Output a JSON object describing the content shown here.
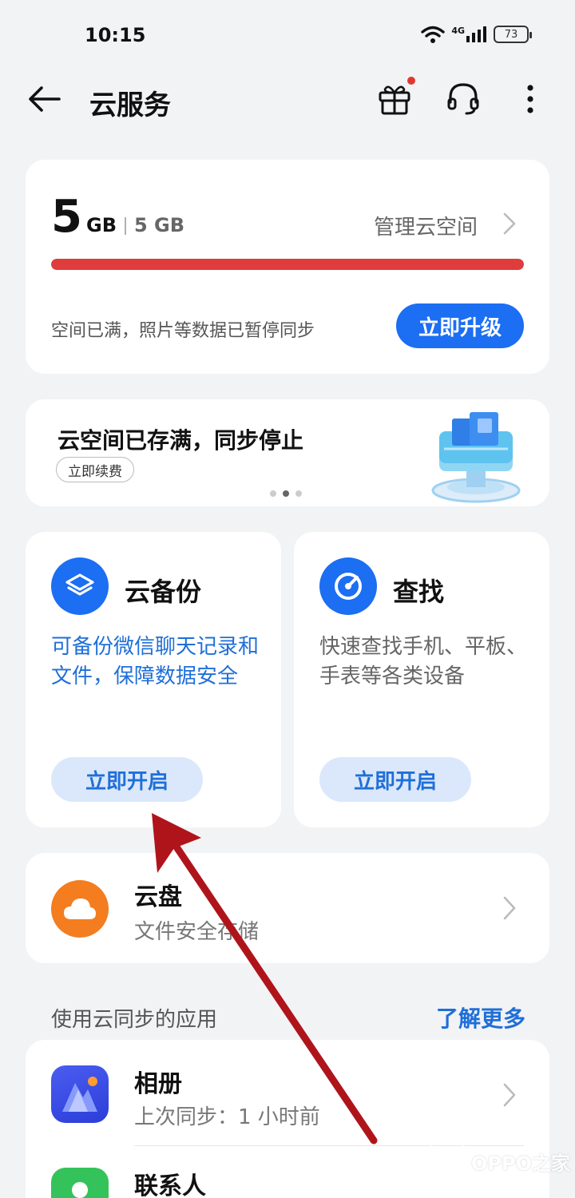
{
  "status_bar": {
    "time": "10:15",
    "network": "4G",
    "battery": "73"
  },
  "header": {
    "title": "云服务"
  },
  "storage": {
    "used_value": "5",
    "used_unit": "GB",
    "total": "5 GB",
    "manage_label": "管理云空间",
    "usage_fraction": 1.0,
    "status_text": "空间已满，照片等数据已暂停同步",
    "upgrade_label": "立即升级"
  },
  "banner": {
    "title": "云空间已存满，同步停止",
    "chip_label": "立即续费",
    "slide_count": 3,
    "active_slide": 1
  },
  "features": {
    "backup": {
      "title": "云备份",
      "description": "可备份微信聊天记录和文件，保障数据安全",
      "button_label": "立即开启"
    },
    "find": {
      "title": "查找",
      "description": "快速查找手机、平板、手表等各类设备",
      "button_label": "立即开启"
    }
  },
  "drive": {
    "title": "云盘",
    "subtitle": "文件安全存储"
  },
  "apps_section": {
    "title": "使用云同步的应用",
    "learn_more": "了解更多",
    "items": [
      {
        "title": "相册",
        "subtitle": "上次同步：1 小时前",
        "icon": "album-icon"
      },
      {
        "title": "联系人",
        "subtitle": "",
        "icon": "contacts-icon"
      }
    ]
  },
  "watermark": {
    "text": "OPPO之家"
  },
  "colors": {
    "accent": "#1c6ef2",
    "danger": "#e03c3c",
    "drive_orange": "#f47d1f",
    "contacts_green": "#34c35a",
    "annotation_red": "#b0141b"
  }
}
